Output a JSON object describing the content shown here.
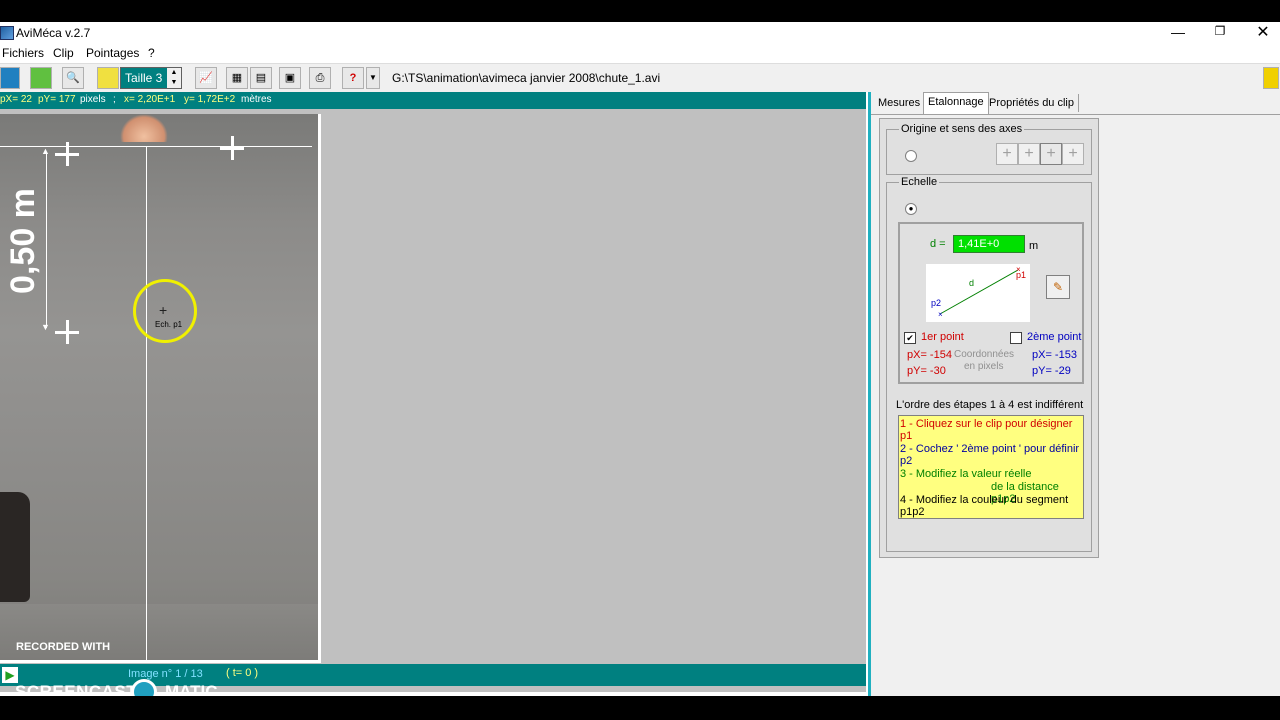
{
  "window": {
    "title": "AviMéca v.2.7"
  },
  "menu": [
    "Fichiers",
    "Clip",
    "Pointages",
    "?"
  ],
  "toolbar": {
    "taille_label": "Taille 3",
    "help_label": "?",
    "file_path": "G:\\TS\\animation\\avimeca janvier 2008\\chute_1.avi"
  },
  "status": {
    "px": "pX= 22",
    "py": "pY= 177",
    "px_unit": "pixels",
    "sep": ";",
    "x": "x= 2,20E+1",
    "y": "y= 1,72E+2",
    "xy_unit": "mètres"
  },
  "video": {
    "scale_text": "0,50 m",
    "marker_label": "Ech. p1",
    "watermark_top": "RECORDED WITH",
    "watermark_bottom": "SCREENCAST",
    "watermark_suffix": "MATIC"
  },
  "bottom": {
    "image_label": "Image n° 1 / 13",
    "time_label": "( t= 0 )"
  },
  "tabs": [
    "Mesures",
    "Etalonnage",
    "Propriétés du clip"
  ],
  "etalonnage": {
    "origin_title": "Origine et sens des axes",
    "echelle_title": "Echelle",
    "d_label": "d =",
    "d_value": "1,41E+0",
    "d_unit": "m",
    "diagram": {
      "d": "d",
      "p1": "p1",
      "p2": "p2"
    },
    "point1": {
      "label": "1er point",
      "checked": true,
      "px": "pX= -154",
      "py": "pY= -30"
    },
    "point2": {
      "label": "2ème point",
      "checked": false,
      "px": "pX= -153",
      "py": "pY= -29"
    },
    "coords_caption_1": "Coordonnées",
    "coords_caption_2": "en pixels",
    "order_title": "L'ordre des étapes 1 à 4 est indifférent",
    "steps": [
      "1 - Cliquez sur le clip pour désigner p1",
      "2 - Cochez ' 2ème point ' pour définir p2",
      "3 - Modifiez la valeur réelle",
      "de la distance p1p2",
      "4 - Modifiez la couleur du segment p1p2"
    ]
  },
  "colors": {
    "teal": "#008080",
    "accent_green": "#00e000",
    "highlight_yellow": "#ffff80",
    "selection_cyan": "#20b0c0"
  }
}
